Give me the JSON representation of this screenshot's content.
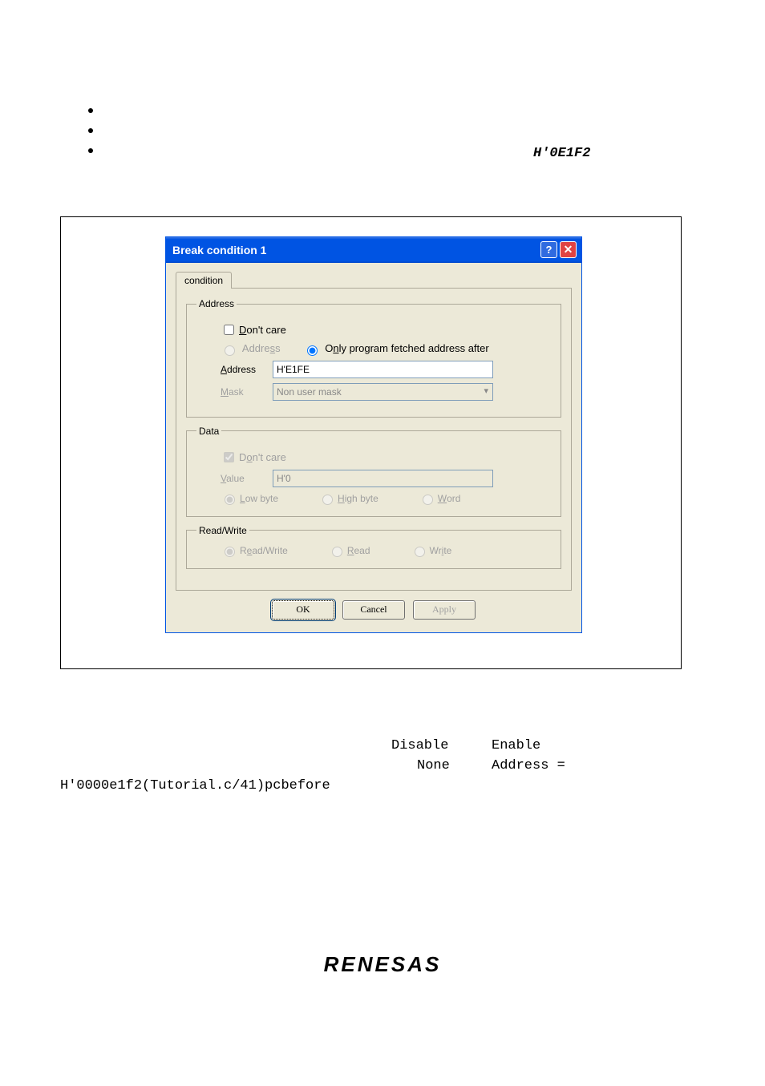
{
  "bullet_code": "H'0E1F2",
  "dialog": {
    "title": "Break condition 1",
    "tab": "condition",
    "address": {
      "legend": "Address",
      "dont_care_label": "Don't care",
      "radio_address_label": "Address",
      "radio_pcafter_label": "Only program fetched address after",
      "address_label": "Address",
      "address_value": "H'E1FE",
      "mask_label": "Mask",
      "mask_value": "Non user mask"
    },
    "data": {
      "legend": "Data",
      "dont_care_label": "Don't care",
      "value_label": "Value",
      "value_value": "H'0",
      "low_label": "Low byte",
      "high_label": "High byte",
      "word_label": "Word"
    },
    "rw": {
      "legend": "Read/Write",
      "rw_label": "Read/Write",
      "read_label": "Read",
      "write_label": "Write"
    },
    "buttons": {
      "ok": "OK",
      "cancel": "Cancel",
      "apply": "Apply"
    }
  },
  "lines": {
    "l1a": "Disable",
    "l1b": "Enable",
    "l2a": "None",
    "l2b": "Address =",
    "l3": "H'0000e1f2(Tutorial.c/41)pcbefore"
  },
  "logo": "RENESAS"
}
